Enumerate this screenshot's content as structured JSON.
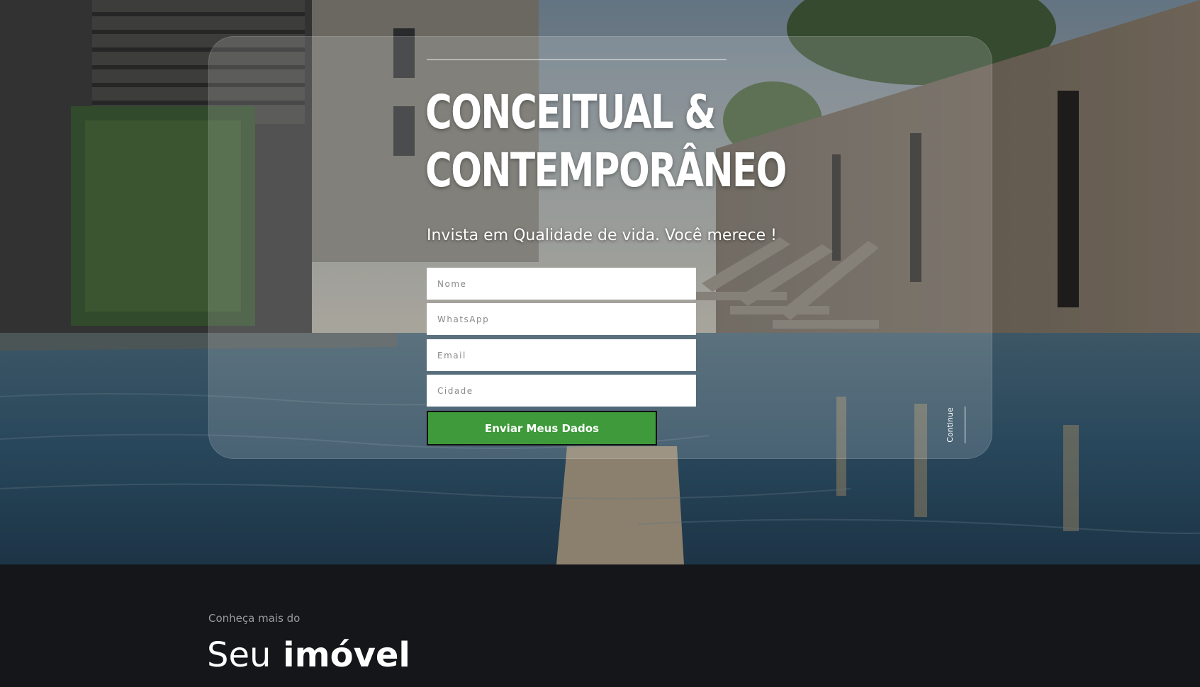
{
  "hero": {
    "headline_line1": "CONCEITUAL &",
    "headline_line2": "CONTEMPORÂNEO",
    "subhead": "Invista em Qualidade de vida. Você merece !",
    "form": {
      "name_placeholder": "Nome",
      "whatsapp_placeholder": "WhatsApp",
      "email_placeholder": "Email",
      "city_placeholder": "Cidade",
      "submit_label": "Enviar Meus Dados"
    },
    "continue_label": "Continue"
  },
  "about": {
    "eyebrow": "Conheça mais do",
    "title_light": "Seu",
    "title_bold": "imóvel"
  },
  "colors": {
    "submit_button": "#3e9a3a",
    "dark_section": "#151619",
    "text_primary": "#ffffff"
  }
}
